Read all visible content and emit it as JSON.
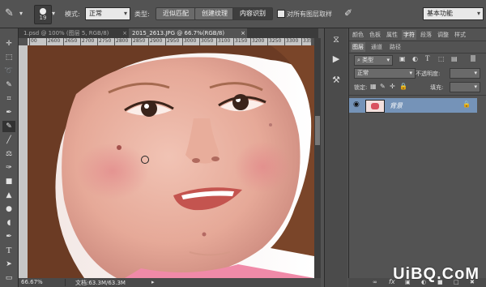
{
  "options_bar": {
    "brush_size": "19",
    "mode_label": "模式:",
    "mode_value": "正常",
    "type_label": "类型:",
    "type_buttons": [
      "近似匹配",
      "创建纹理",
      "内容识别"
    ],
    "sample_all_layers_label": "对所有图层取样",
    "workspace_value": "基本功能"
  },
  "doc_tabs": [
    {
      "label": "1.psd @ 100% (图层 5, RGB/8)"
    },
    {
      "label": "2015_2613.JPG @ 66.7%(RGB/8)"
    }
  ],
  "ruler": {
    "h_ticks": [
      "00",
      "2600",
      "2650",
      "2700",
      "2750",
      "2800",
      "2850",
      "2900",
      "2950",
      "3000",
      "3050",
      "3100",
      "3150",
      "3200",
      "3250",
      "3300",
      "3350"
    ]
  },
  "status_bar": {
    "zoom": "66.67%",
    "doc_info": "文档:63.3M/63.3M"
  },
  "panel_tabs_top": [
    "颜色",
    "色板",
    "属性",
    "字符",
    "段落",
    "调整",
    "样式"
  ],
  "panel_tabs_layers": [
    "图层",
    "通道",
    "路径"
  ],
  "layers_panel": {
    "filter_label": "类型",
    "blend_mode": "正常",
    "opacity_label": "不透明度:",
    "lock_label": "锁定:",
    "fill_label": "填充:",
    "layers": [
      {
        "name": "背景",
        "locked": true,
        "visible": true
      }
    ]
  },
  "watermark": "UiBQ.CoM",
  "colors": {
    "ui_bg": "#535353",
    "ui_dark": "#3b3b3b",
    "selected_layer": "#7593b8",
    "ruler": "#c6c6c6"
  }
}
